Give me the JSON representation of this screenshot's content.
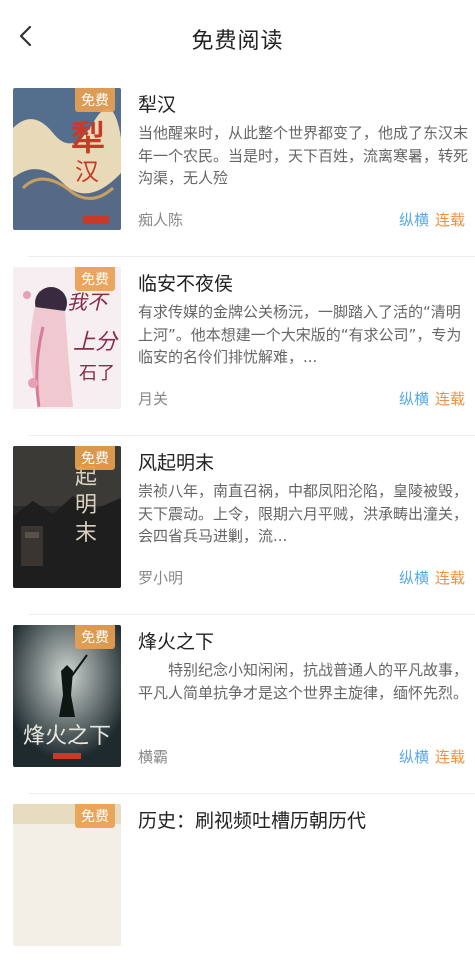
{
  "header": {
    "title": "免费阅读"
  },
  "badge_label": "免费",
  "books": [
    {
      "title": "犁汉",
      "desc": "当他醒来时，从此整个世界都变了，他成了东汉末年一个农民。当是时，天下百姓，流离寒暑，转死沟渠，无人殓",
      "author": "痴人陈",
      "genre": "纵横",
      "status": "连载",
      "cover_title": "犁汉",
      "cover_colors": [
        "#e8d9b8",
        "#2f4d7a",
        "#c83a26"
      ]
    },
    {
      "title": "临安不夜侯",
      "desc": "有求传媒的金牌公关杨沅，一脚踏入了活的“清明上河”。他本想建一个大宋版的“有求公司”，专为临安的名伶们排忧解难，...",
      "author": "月关",
      "genre": "纵横",
      "status": "连载",
      "cover_title": "临安不夜侯",
      "cover_colors": [
        "#f6eef0",
        "#d77a9a",
        "#3a2a40"
      ]
    },
    {
      "title": "风起明末",
      "desc": "崇祯八年，南直召祸，中都凤阳沦陷，皇陵被毁，天下震动。上令，限期六月平贼，洪承畴出潼关，会四省兵马进剿，流...",
      "author": "罗小明",
      "genre": "纵横",
      "status": "连载",
      "cover_title": "风起明末",
      "cover_colors": [
        "#2a2a2a",
        "#5a5048",
        "#d8d0c0"
      ]
    },
    {
      "title": "烽火之下",
      "desc": "特别纪念小知闲闲，抗战普通人的平凡故事，平凡人简单抗争才是这个世界主旋律，缅怀先烈。",
      "author": "横霸",
      "genre": "纵横",
      "status": "连载",
      "cover_title": "烽火之下",
      "cover_colors": [
        "#1e2a2e",
        "#6a7a78",
        "#e8e8e0"
      ]
    },
    {
      "title": "历史：刷视频吐槽历朝历代",
      "desc": "",
      "author": "",
      "genre": "",
      "status": "",
      "cover_title": "",
      "cover_colors": [
        "#f2efe6",
        "#d8b070",
        "#333333"
      ]
    }
  ]
}
